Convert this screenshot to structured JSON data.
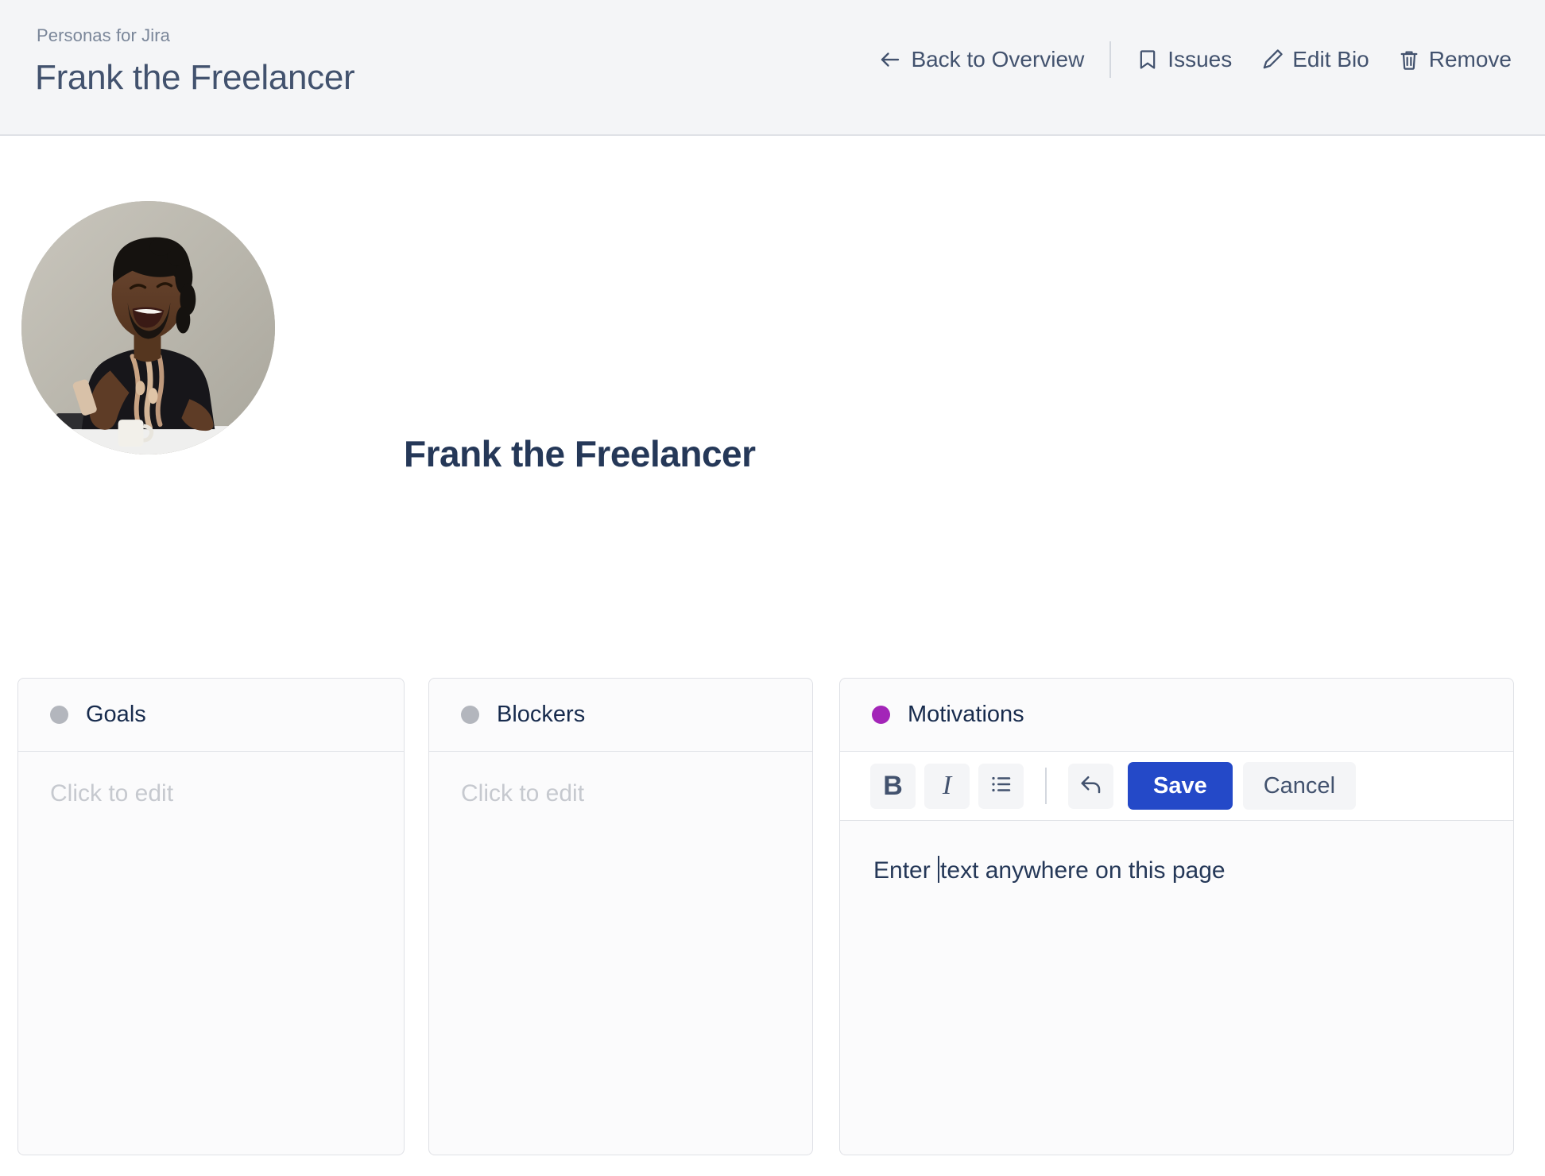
{
  "header": {
    "breadcrumb": "Personas for Jira",
    "title": "Frank the Freelancer",
    "actions": [
      {
        "label": "Back to Overview",
        "icon": "arrow-left-icon"
      },
      {
        "label": "Issues",
        "icon": "bookmark-icon"
      },
      {
        "label": "Edit Bio",
        "icon": "pencil-icon"
      },
      {
        "label": "Remove",
        "icon": "trash-icon"
      }
    ]
  },
  "profile": {
    "name": "Frank the Freelancer",
    "avatar_alt": "avatar-photo"
  },
  "cards": [
    {
      "title": "Goals",
      "dot_color": "#b3b6bd",
      "placeholder": "Click to edit",
      "editing": false
    },
    {
      "title": "Blockers",
      "dot_color": "#b3b6bd",
      "placeholder": "Click to edit",
      "editing": false
    },
    {
      "title": "Motivations",
      "dot_color": "#a325b8",
      "placeholder": "Click to edit",
      "editing": true
    }
  ],
  "editor": {
    "toolbar": {
      "bold_label": "B",
      "italic_label": "I",
      "list_icon": "bullet-list-icon",
      "undo_icon": "undo-icon",
      "save_label": "Save",
      "cancel_label": "Cancel"
    },
    "text_before_caret": "Enter ",
    "text_after_caret": "text anywhere on this page"
  },
  "colors": {
    "header_bg": "#f4f5f7",
    "primary_button": "#2449c8",
    "motivations_dot": "#a325b8",
    "text_dark": "#172b4d"
  }
}
